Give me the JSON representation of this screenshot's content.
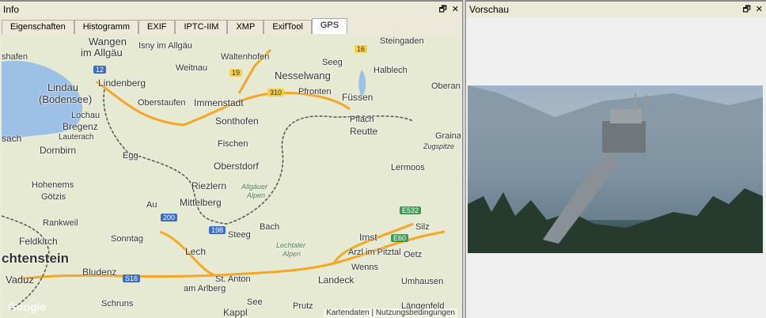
{
  "left_panel": {
    "title": "Info",
    "tabs": [
      "Eigenschaften",
      "Histogramm",
      "EXIF",
      "IPTC-IIM",
      "XMP",
      "ExifTool",
      "GPS"
    ],
    "active_tab": "GPS"
  },
  "right_panel": {
    "title": "Vorschau"
  },
  "controls": {
    "restore": "🗗",
    "close": "✕"
  },
  "map": {
    "labels": [
      "Wangen",
      "im Allgäu",
      "Isny im Allgäu",
      "Steingaden",
      "shafen",
      "Waltenhofen",
      "Seeg",
      "Weitnau",
      "Halblech",
      "Lindau",
      "(Bodensee)",
      "Lindenberg",
      "Nesselwang",
      "Immenstadt",
      "Pfronten",
      "Oberan",
      "Lochau",
      "Oberstaufen",
      "Füssen",
      "Bregenz",
      "Lauterach",
      "Sonthofen",
      "Pflach",
      "Reutte",
      "Graina",
      "sach",
      "Fischen",
      "Zugspitze",
      "Dornbirn",
      "Egg",
      "Oberstdorf",
      "Lermoos",
      "Hohenems",
      "Götzis",
      "Riezlern",
      "Allgäuer",
      "Alpen",
      "Au",
      "Mittelberg",
      "Rankweil",
      "Bach",
      "Imst",
      "Silz",
      "Feldkirch",
      "Sonntag",
      "Steeg",
      "Lechtaler",
      "Alpen",
      "chtenstein",
      "Lech",
      "Arzl im Pitztal",
      "Oetz",
      "Vaduz",
      "Bludenz",
      "St. Anton",
      "Landeck",
      "Wenns",
      "Umhausen",
      "am Arlberg",
      "Schruns",
      "See",
      "Kappl",
      "Prutz",
      "Längenfeld"
    ],
    "shields": [
      "12",
      "19",
      "16",
      "310",
      "200",
      "198",
      "S16",
      "E532",
      "E60"
    ],
    "attribution": {
      "kartendaten": "Kartendaten",
      "terms": "Nutzungsbedingungen",
      "logo": "Google"
    }
  }
}
